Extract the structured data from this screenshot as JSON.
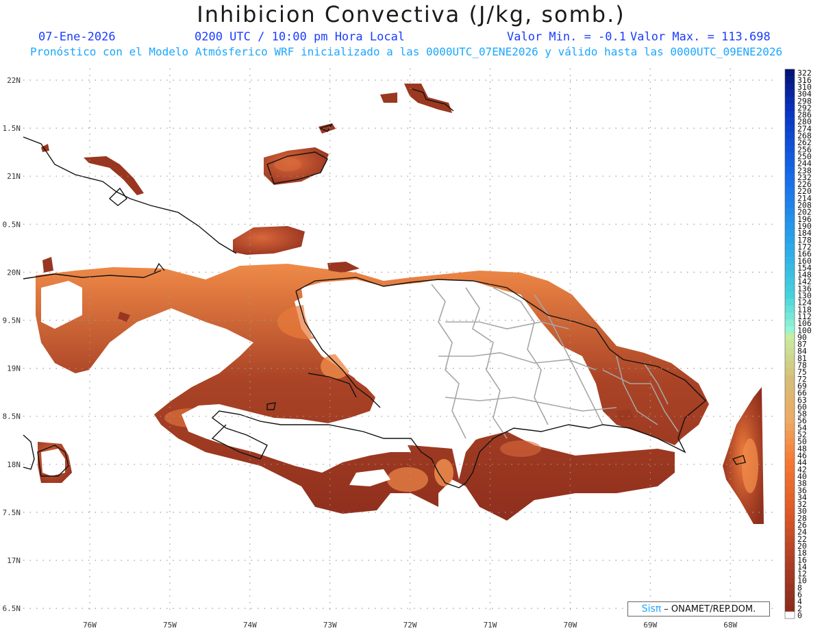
{
  "header": {
    "title": "Inhibicion Convectiva (J/kg, somb.)",
    "date": "07-Ene-2026",
    "time": "0200 UTC / 10:00 pm Hora Local",
    "min_label": "Valor Min. = -0.1",
    "max_label": "Valor Max. = 113.698",
    "model_line": "Pronóstico con el Modelo Atmósferico WRF inicializado a las 0000UTC_07ENE2026 y válido hasta las  0000UTC_09ENE2026"
  },
  "map": {
    "lon_labels": [
      "76W",
      "75W",
      "74W",
      "73W",
      "72W",
      "71W",
      "70W",
      "69W",
      "68W"
    ],
    "lat_labels": [
      "22N",
      "1.5N",
      "21N",
      "0.5N",
      "20N",
      "9.5N",
      "19N",
      "8.5N",
      "18N",
      "7.5N",
      "17N",
      "6.5N"
    ],
    "colors": {
      "land_outline": "#111111",
      "province_border": "#a6a6a6",
      "grid": "#9a9a9a",
      "field_light": "#e88b52",
      "field_dark": "#8f2f1d"
    }
  },
  "colorbar": {
    "labels": [
      "322",
      "316",
      "310",
      "304",
      "298",
      "292",
      "286",
      "280",
      "274",
      "268",
      "262",
      "256",
      "250",
      "244",
      "238",
      "232",
      "226",
      "220",
      "214",
      "208",
      "202",
      "196",
      "190",
      "184",
      "178",
      "172",
      "166",
      "160",
      "154",
      "148",
      "142",
      "136",
      "130",
      "124",
      "118",
      "112",
      "106",
      "100",
      "90",
      "87",
      "84",
      "81",
      "78",
      "75",
      "72",
      "69",
      "66",
      "63",
      "60",
      "58",
      "56",
      "54",
      "52",
      "50",
      "48",
      "46",
      "44",
      "42",
      "40",
      "38",
      "36",
      "34",
      "32",
      "30",
      "28",
      "26",
      "24",
      "22",
      "20",
      "18",
      "16",
      "14",
      "12",
      "10",
      "8",
      "6",
      "4",
      "2",
      "0"
    ]
  },
  "credit": {
    "brand": "Sisπ",
    "org": "– ONAMET/REP.DOM."
  }
}
